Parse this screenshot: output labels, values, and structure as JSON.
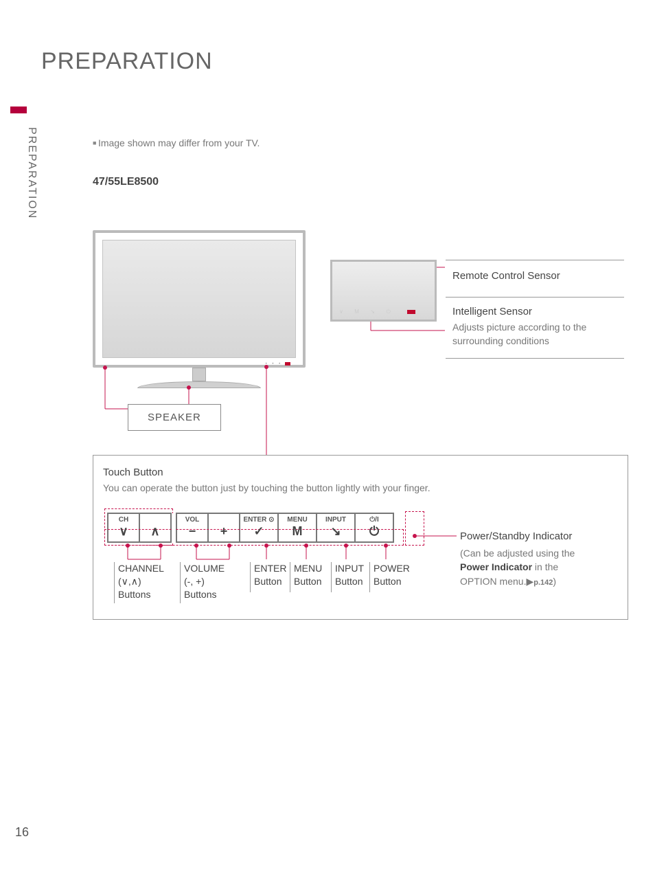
{
  "page": {
    "title": "PREPARATION",
    "side_label": "PREPARATION",
    "note": "Image shown may differ from your TV.",
    "model": "47/55LE8500",
    "number": "16"
  },
  "labels": {
    "speaker": "SPEAKER",
    "remote_sensor": "Remote Control Sensor",
    "intel_sensor_title": "Intelligent Sensor",
    "intel_sensor_desc": "Adjusts picture according to the surrounding conditions"
  },
  "touch": {
    "title": "Touch Button",
    "desc": "You can operate the button just by touching the button lightly with your finger.",
    "headers": {
      "ch": "CH",
      "vol": "VOL",
      "enter": "ENTER ⊙",
      "menu": "MENU",
      "input": "INPUT",
      "power": "⏻/I"
    },
    "symbols": {
      "ch_down": "∨",
      "ch_up": "∧",
      "vol_down": "−",
      "vol_up": "+",
      "enter": "✓",
      "menu": "M",
      "input": "↘",
      "power": "⏻"
    },
    "button_labels": {
      "channel_1": "CHANNEL",
      "channel_2": "(∨,∧)",
      "channel_3": "Buttons",
      "volume_1": "VOLUME",
      "volume_2": "(-, +)",
      "volume_3": "Buttons",
      "enter_1": "ENTER",
      "enter_2": "Button",
      "menu_1": "MENU",
      "menu_2": "Button",
      "input_1": "INPUT",
      "input_2": "Button",
      "power_1": "POWER",
      "power_2": "Button"
    },
    "power_indicator": {
      "title": "Power/Standby Indicator",
      "line1": "(Can be adjusted using the",
      "strong": "Power Indicator",
      "line2_tail": " in the",
      "line3": "OPTION menu.▶",
      "pref": "p.142",
      "tail": ")"
    }
  }
}
